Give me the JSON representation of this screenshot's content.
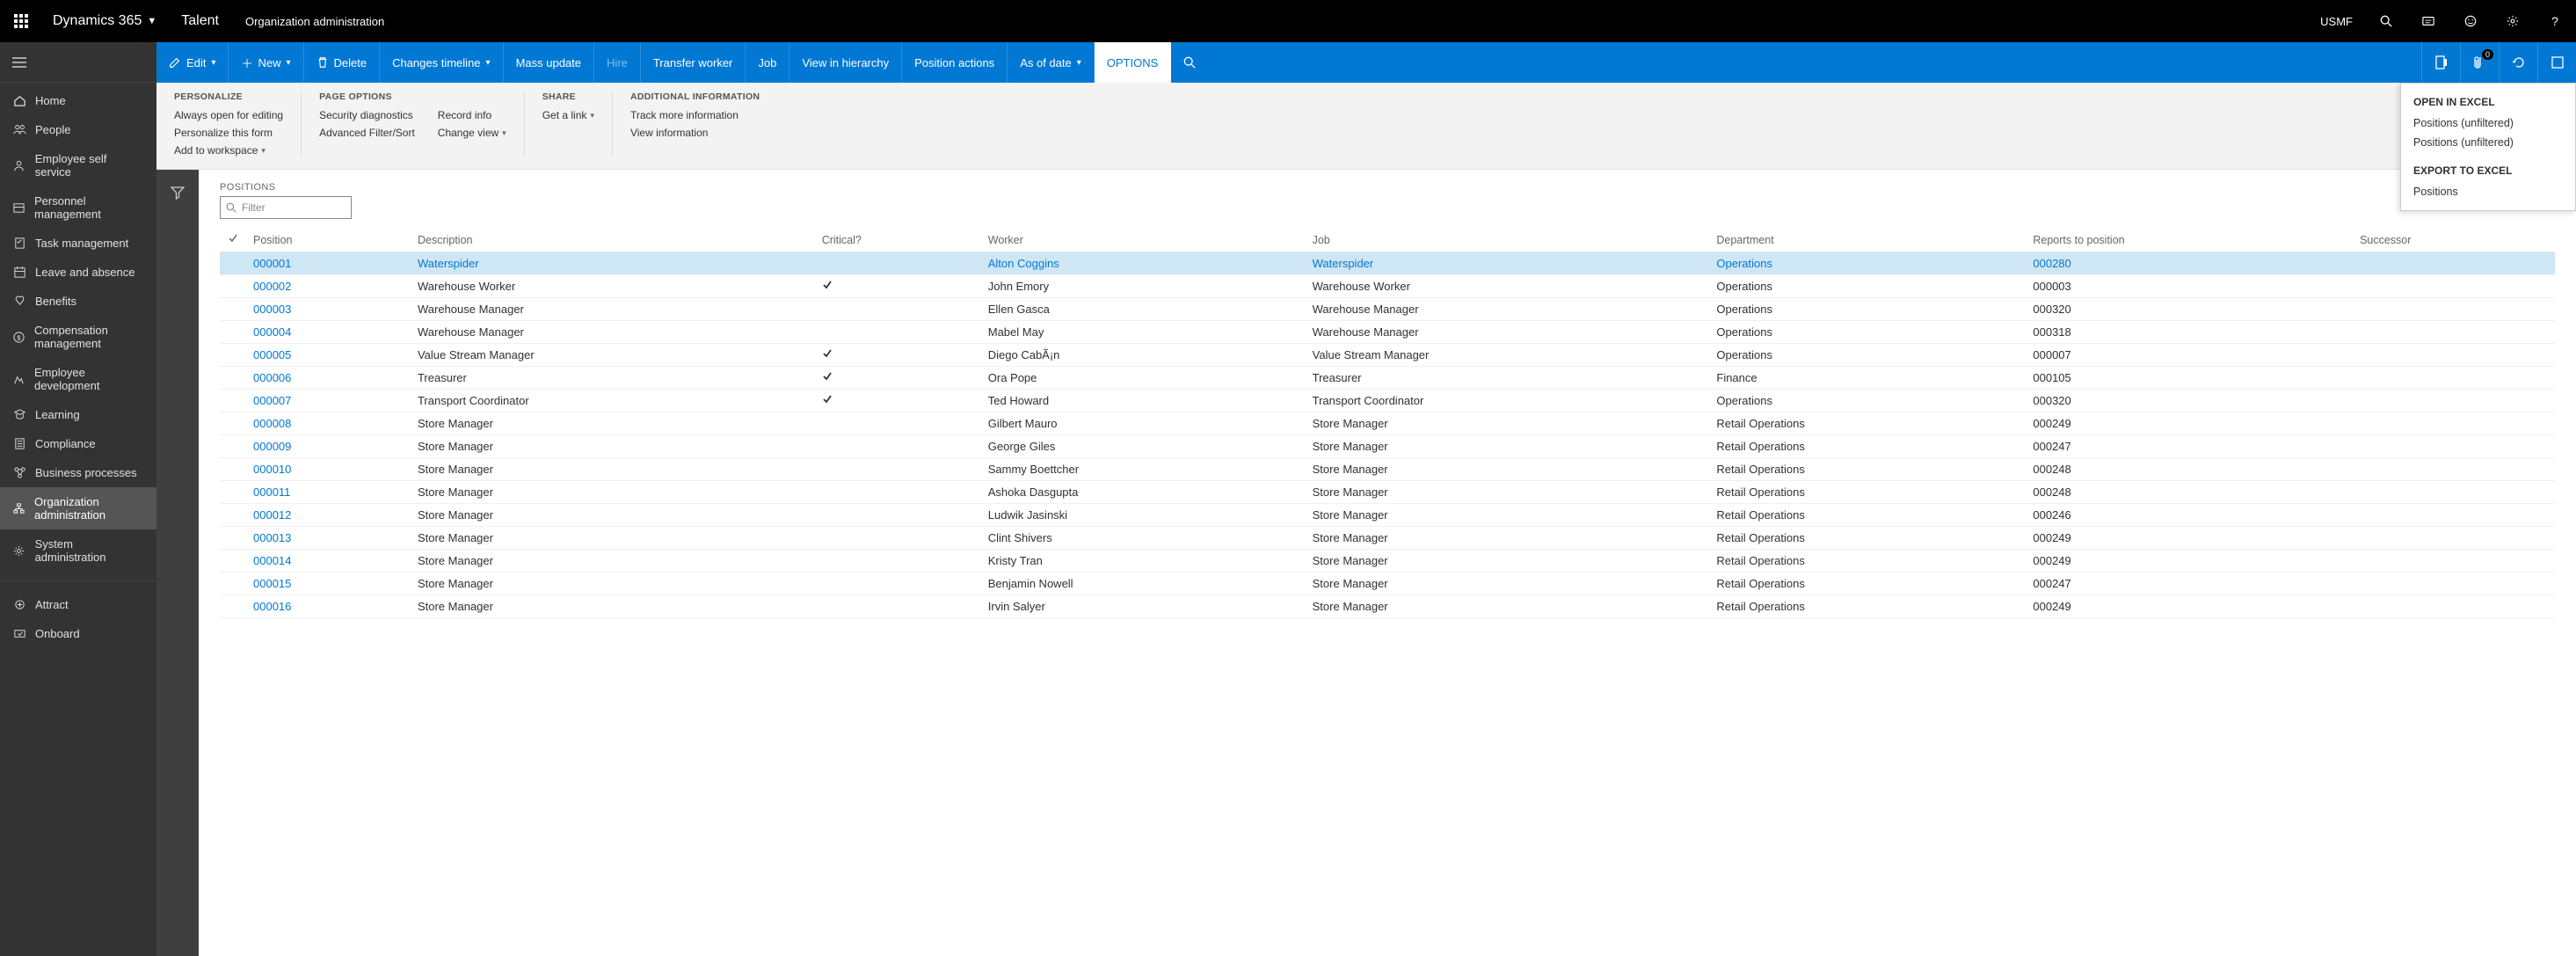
{
  "topbar": {
    "brand": "Dynamics 365",
    "app": "Talent",
    "breadcrumb": "Organization administration",
    "company": "USMF"
  },
  "leftnav": {
    "items": [
      {
        "icon": "home",
        "label": "Home"
      },
      {
        "icon": "people",
        "label": "People"
      },
      {
        "icon": "self",
        "label": "Employee self service"
      },
      {
        "icon": "pm",
        "label": "Personnel management"
      },
      {
        "icon": "task",
        "label": "Task management"
      },
      {
        "icon": "leave",
        "label": "Leave and absence"
      },
      {
        "icon": "benefits",
        "label": "Benefits"
      },
      {
        "icon": "comp",
        "label": "Compensation management"
      },
      {
        "icon": "dev",
        "label": "Employee development"
      },
      {
        "icon": "learn",
        "label": "Learning"
      },
      {
        "icon": "compl",
        "label": "Compliance"
      },
      {
        "icon": "bp",
        "label": "Business processes"
      },
      {
        "icon": "org",
        "label": "Organization administration",
        "active": true
      },
      {
        "icon": "sys",
        "label": "System administration"
      }
    ],
    "items2": [
      {
        "icon": "attract",
        "label": "Attract"
      },
      {
        "icon": "onboard",
        "label": "Onboard"
      }
    ]
  },
  "actionbar": {
    "edit": "Edit",
    "new": "New",
    "delete": "Delete",
    "changes": "Changes timeline",
    "mass": "Mass update",
    "hire": "Hire",
    "transfer": "Transfer worker",
    "job": "Job",
    "hierarchy": "View in hierarchy",
    "posactions": "Position actions",
    "asof": "As of date",
    "options": "OPTIONS",
    "badge": "0"
  },
  "ribbon": {
    "personalize": {
      "hdr": "PERSONALIZE",
      "items": [
        "Always open for editing",
        "Personalize this form",
        "Add to workspace"
      ]
    },
    "pageoptions": {
      "hdr": "PAGE OPTIONS",
      "col1": [
        "Security diagnostics",
        "Advanced Filter/Sort"
      ],
      "col2": [
        "Record info",
        "Change view"
      ]
    },
    "share": {
      "hdr": "SHARE",
      "items": [
        "Get a link"
      ]
    },
    "addl": {
      "hdr": "ADDITIONAL INFORMATION",
      "items": [
        "Track more information",
        "View information"
      ]
    }
  },
  "grid": {
    "title": "POSITIONS",
    "filter_placeholder": "Filter",
    "columns": [
      "",
      "Position",
      "Description",
      "Critical?",
      "Worker",
      "Job",
      "Department",
      "Reports to position",
      "Successor"
    ],
    "rows": [
      {
        "sel": true,
        "position": "000001",
        "description": "Waterspider",
        "critical": false,
        "worker": "Alton Coggins",
        "job": "Waterspider",
        "department": "Operations",
        "reports": "000280",
        "successor": ""
      },
      {
        "position": "000002",
        "description": "Warehouse Worker",
        "critical": true,
        "worker": "John Emory",
        "job": "Warehouse Worker",
        "department": "Operations",
        "reports": "000003",
        "successor": ""
      },
      {
        "position": "000003",
        "description": "Warehouse Manager",
        "critical": false,
        "worker": "Ellen Gasca",
        "job": "Warehouse Manager",
        "department": "Operations",
        "reports": "000320",
        "successor": ""
      },
      {
        "position": "000004",
        "description": "Warehouse Manager",
        "critical": false,
        "worker": "Mabel May",
        "job": "Warehouse Manager",
        "department": "Operations",
        "reports": "000318",
        "successor": ""
      },
      {
        "position": "000005",
        "description": "Value Stream Manager",
        "critical": true,
        "worker": "Diego CabÃ¡n",
        "job": "Value Stream Manager",
        "department": "Operations",
        "reports": "000007",
        "successor": ""
      },
      {
        "position": "000006",
        "description": "Treasurer",
        "critical": true,
        "worker": "Ora Pope",
        "job": "Treasurer",
        "department": "Finance",
        "reports": "000105",
        "successor": ""
      },
      {
        "position": "000007",
        "description": "Transport Coordinator",
        "critical": true,
        "worker": "Ted Howard",
        "job": "Transport Coordinator",
        "department": "Operations",
        "reports": "000320",
        "successor": ""
      },
      {
        "position": "000008",
        "description": "Store Manager",
        "critical": false,
        "worker": "Gilbert Mauro",
        "job": "Store Manager",
        "department": "Retail Operations",
        "reports": "000249",
        "successor": ""
      },
      {
        "position": "000009",
        "description": "Store Manager",
        "critical": false,
        "worker": "George Giles",
        "job": "Store Manager",
        "department": "Retail Operations",
        "reports": "000247",
        "successor": ""
      },
      {
        "position": "000010",
        "description": "Store Manager",
        "critical": false,
        "worker": "Sammy Boettcher",
        "job": "Store Manager",
        "department": "Retail Operations",
        "reports": "000248",
        "successor": ""
      },
      {
        "position": "000011",
        "description": "Store Manager",
        "critical": false,
        "worker": "Ashoka Dasgupta",
        "job": "Store Manager",
        "department": "Retail Operations",
        "reports": "000248",
        "successor": ""
      },
      {
        "position": "000012",
        "description": "Store Manager",
        "critical": false,
        "worker": "Ludwik Jasinski",
        "job": "Store Manager",
        "department": "Retail Operations",
        "reports": "000246",
        "successor": ""
      },
      {
        "position": "000013",
        "description": "Store Manager",
        "critical": false,
        "worker": "Clint Shivers",
        "job": "Store Manager",
        "department": "Retail Operations",
        "reports": "000249",
        "successor": ""
      },
      {
        "position": "000014",
        "description": "Store Manager",
        "critical": false,
        "worker": "Kristy Tran",
        "job": "Store Manager",
        "department": "Retail Operations",
        "reports": "000249",
        "successor": ""
      },
      {
        "position": "000015",
        "description": "Store Manager",
        "critical": false,
        "worker": "Benjamin Nowell",
        "job": "Store Manager",
        "department": "Retail Operations",
        "reports": "000247",
        "successor": ""
      },
      {
        "position": "000016",
        "description": "Store Manager",
        "critical": false,
        "worker": "Irvin Salyer",
        "job": "Store Manager",
        "department": "Retail Operations",
        "reports": "000249",
        "successor": ""
      }
    ]
  },
  "flyout": {
    "openhdr": "OPEN IN EXCEL",
    "open1": "Positions (unfiltered)",
    "open2": "Positions (unfiltered)",
    "exporthdr": "EXPORT TO EXCEL",
    "export1": "Positions"
  }
}
